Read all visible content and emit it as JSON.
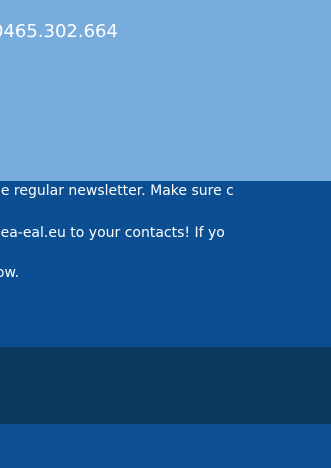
{
  "contact": {
    "phone": "0465.302.664"
  },
  "newsletter": {
    "lines": [
      "he regular newsletter. Make sure c",
      "aea-eal.eu to your contacts! If yo",
      "low."
    ]
  },
  "colors": {
    "contact_band": "#78acdd",
    "newsletter_band": "#0b4e91",
    "dark_band": "#0a3a5f",
    "bottom_band": "#0c4f92",
    "text": "#ffffff"
  }
}
